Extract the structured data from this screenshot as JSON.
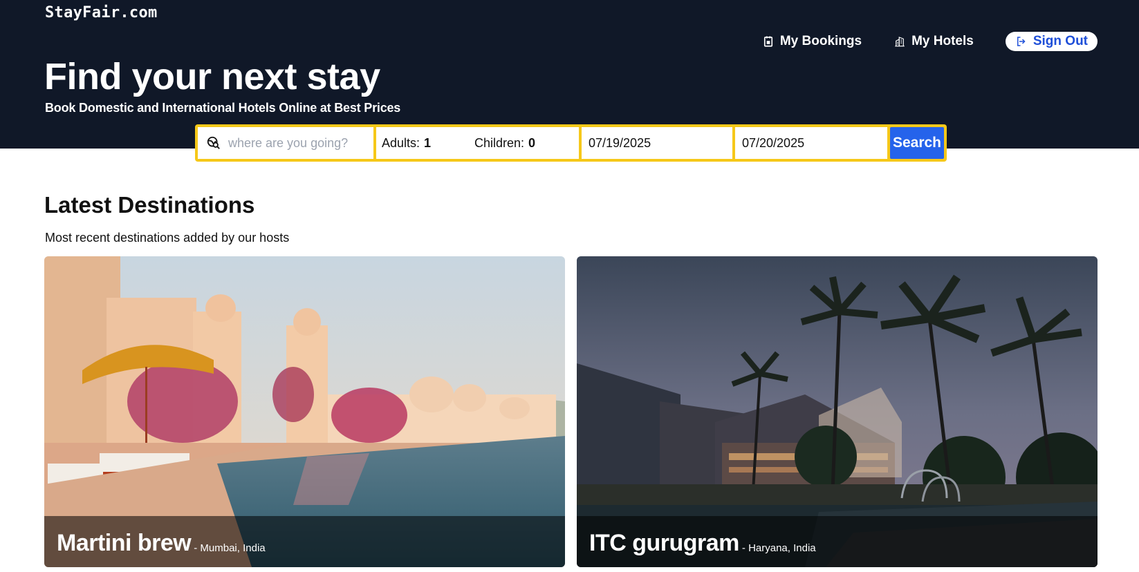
{
  "brand": "StayFair.com",
  "nav": {
    "my_bookings": "My Bookings",
    "my_hotels": "My Hotels",
    "sign_out": "Sign Out"
  },
  "hero": {
    "title": "Find your next stay",
    "subtitle": "Book Domestic and International Hotels Online at Best Prices"
  },
  "search": {
    "destination_placeholder": "where are you going?",
    "destination_value": "",
    "adults_label": "Adults:",
    "adults_value": "1",
    "children_label": "Children:",
    "children_value": "0",
    "check_in": "07/19/2025",
    "check_out": "07/20/2025",
    "button": "Search"
  },
  "destinations": {
    "title": "Latest Destinations",
    "subtitle": "Most recent destinations added by our hosts",
    "items": [
      {
        "name": "Martini brew",
        "location": "- Mumbai, India"
      },
      {
        "name": "ITC gurugram",
        "location": "- Haryana, India"
      }
    ]
  },
  "colors": {
    "header_bg": "#101828",
    "search_border": "#f6c819",
    "search_button": "#2563eb",
    "sign_out_text": "#1d4ed8"
  },
  "icons": {
    "bookings": "calendar-icon",
    "hotels": "building-icon",
    "sign_out": "sign-out-icon",
    "destination": "globe-search-icon"
  }
}
